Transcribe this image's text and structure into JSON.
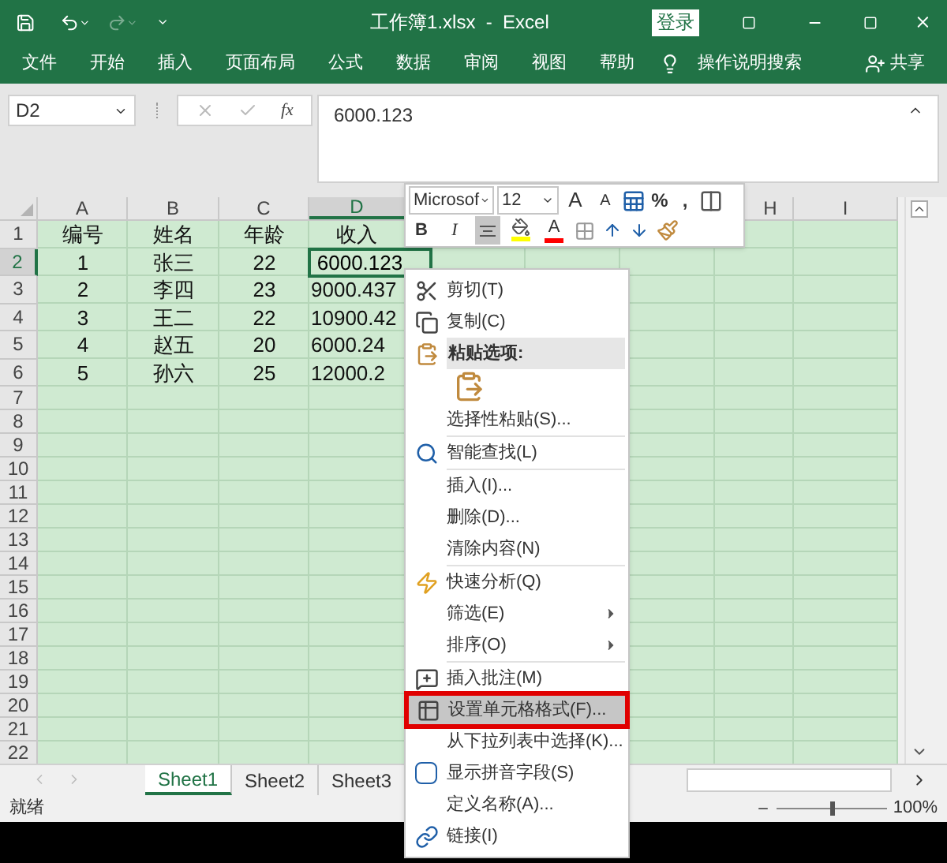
{
  "title_bar": {
    "title": "工作簿1.xlsx  -  Excel",
    "sign_in": "登录",
    "redo_disabled": true
  },
  "ribbon_tabs": [
    "文件",
    "开始",
    "插入",
    "页面布局",
    "公式",
    "数据",
    "审阅",
    "视图",
    "帮助"
  ],
  "tell_me": "操作说明搜索",
  "share": "共享",
  "formula_bar": {
    "name_box": "D2",
    "fx": "fx",
    "value": "6000.123"
  },
  "sheet": {
    "columns": [
      {
        "label": "A",
        "selected": false
      },
      {
        "label": "B",
        "selected": false
      },
      {
        "label": "C",
        "selected": false
      },
      {
        "label": "D",
        "selected": true
      },
      {
        "label": "H",
        "selected": false
      },
      {
        "label": "I",
        "selected": false
      }
    ],
    "rows": [
      {
        "number": "1",
        "selected": false,
        "cells": [
          {
            "text": "编号",
            "active": false
          },
          {
            "text": "姓名",
            "active": false
          },
          {
            "text": "年龄",
            "active": false
          },
          {
            "text": "收入",
            "active": false
          }
        ]
      },
      {
        "number": "2",
        "selected": true,
        "cells": [
          {
            "text": "1",
            "active": false
          },
          {
            "text": "张三",
            "active": false
          },
          {
            "text": "22",
            "active": false
          },
          {
            "text": "6000.123",
            "active": true
          }
        ]
      },
      {
        "number": "3",
        "selected": false,
        "cells": [
          {
            "text": "2",
            "active": false
          },
          {
            "text": "李四",
            "active": false
          },
          {
            "text": "23",
            "active": false
          },
          {
            "text": "9000.437",
            "active": false
          }
        ]
      },
      {
        "number": "4",
        "selected": false,
        "cells": [
          {
            "text": "3",
            "active": false
          },
          {
            "text": "王二",
            "active": false
          },
          {
            "text": "22",
            "active": false
          },
          {
            "text": "10900.42",
            "active": false
          }
        ]
      },
      {
        "number": "5",
        "selected": false,
        "cells": [
          {
            "text": "4",
            "active": false
          },
          {
            "text": "赵五",
            "active": false
          },
          {
            "text": "20",
            "active": false
          },
          {
            "text": "6000.24",
            "active": false
          }
        ]
      },
      {
        "number": "6",
        "selected": false,
        "cells": [
          {
            "text": "5",
            "active": false
          },
          {
            "text": "孙六",
            "active": false
          },
          {
            "text": "25",
            "active": false
          },
          {
            "text": "12000.2",
            "active": false
          }
        ]
      },
      {
        "number": "7",
        "selected": false
      },
      {
        "number": "8",
        "selected": false
      },
      {
        "number": "9",
        "selected": false
      },
      {
        "number": "10",
        "selected": false
      },
      {
        "number": "11",
        "selected": false
      },
      {
        "number": "12",
        "selected": false
      },
      {
        "number": "13",
        "selected": false
      },
      {
        "number": "14",
        "selected": false
      },
      {
        "number": "15",
        "selected": false
      },
      {
        "number": "16",
        "selected": false
      },
      {
        "number": "17",
        "selected": false
      },
      {
        "number": "18",
        "selected": false
      },
      {
        "number": "19",
        "selected": false
      },
      {
        "number": "20",
        "selected": false
      },
      {
        "number": "21",
        "selected": false
      },
      {
        "number": "22",
        "selected": false
      }
    ]
  },
  "sheet_tabs": [
    {
      "label": "Sheet1",
      "selected": true
    },
    {
      "label": "Sheet2",
      "selected": false
    },
    {
      "label": "Sheet3",
      "selected": false
    }
  ],
  "status": "就绪",
  "zoom": "100%",
  "zoom_slider": {
    "level": 0.5
  },
  "mini_toolbar": {
    "row1": [
      {
        "kind": "font",
        "text": "Microsof"
      },
      {
        "kind": "size",
        "text": "12"
      },
      {
        "kind": "grow",
        "text": "A"
      },
      {
        "kind": "shrink",
        "text": "A"
      },
      {
        "kind": "accounting"
      },
      {
        "kind": "glyph",
        "text": "%"
      },
      {
        "kind": "glyph",
        "text": ","
      },
      {
        "kind": "styles"
      }
    ],
    "row2": [
      {
        "kind": "bold",
        "text": "B"
      },
      {
        "kind": "italic",
        "text": "I"
      },
      {
        "kind": "align",
        "selected": true
      },
      {
        "kind": "fill",
        "color": "#ffff00"
      },
      {
        "kind": "fontcolor",
        "text": "A",
        "color": "#ff0000"
      },
      {
        "kind": "borders"
      },
      {
        "kind": "incdec"
      },
      {
        "kind": "decdec"
      },
      {
        "kind": "painter"
      }
    ]
  },
  "context_menu": [
    {
      "kind": "item",
      "label": "剪切(T)",
      "selected": false
    },
    {
      "kind": "item",
      "label": "复制(C)",
      "selected": false
    },
    {
      "kind": "header",
      "label": "粘贴选项:"
    },
    {
      "kind": "paste"
    },
    {
      "kind": "item",
      "label": "选择性粘贴(S)...",
      "selected": false
    },
    {
      "kind": "separator"
    },
    {
      "kind": "item",
      "label": "智能查找(L)",
      "selected": false
    },
    {
      "kind": "separator"
    },
    {
      "kind": "item",
      "label": "插入(I)...",
      "selected": false
    },
    {
      "kind": "item",
      "label": "删除(D)...",
      "selected": false
    },
    {
      "kind": "item",
      "label": "清除内容(N)",
      "selected": false
    },
    {
      "kind": "separator"
    },
    {
      "kind": "item",
      "label": "快速分析(Q)",
      "selected": false
    },
    {
      "kind": "submenu",
      "label": "筛选(E)",
      "selected": false
    },
    {
      "kind": "submenu",
      "label": "排序(O)",
      "selected": false
    },
    {
      "kind": "separator"
    },
    {
      "kind": "item",
      "label": "插入批注(M)",
      "selected": false
    },
    {
      "kind": "item",
      "label": "设置单元格格式(F)...",
      "selected": true
    },
    {
      "kind": "item",
      "label": "从下拉列表中选择(K)...",
      "selected": false
    },
    {
      "kind": "item",
      "label": "显示拼音字段(S)",
      "selected": false
    },
    {
      "kind": "item",
      "label": "定义名称(A)...",
      "selected": false
    },
    {
      "kind": "item",
      "label": "链接(I)",
      "selected": false
    }
  ]
}
